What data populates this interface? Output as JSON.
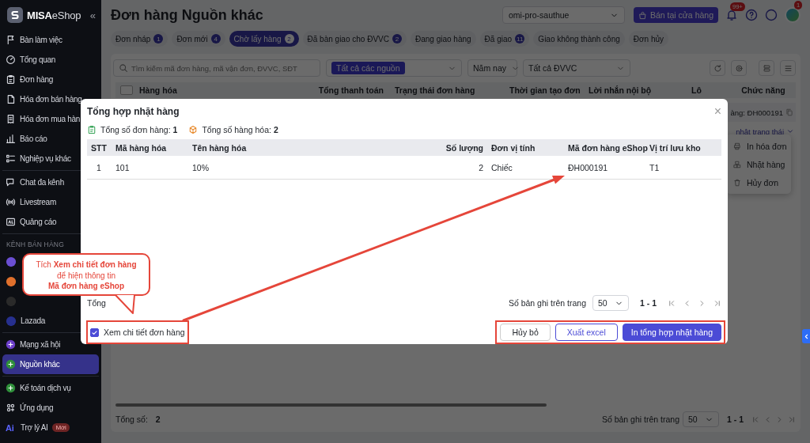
{
  "sidebar": {
    "brand": "**MISA**eShop",
    "collapse": "«",
    "groups": [
      {
        "kind": "menu",
        "items": [
          {
            "label": "Bàn làm việc",
            "selected": false
          },
          {
            "label": "Tổng quan",
            "selected": false
          },
          {
            "label": "Đơn hàng",
            "selected": false
          },
          {
            "label": "Hóa đơn bán hàng",
            "selected": false
          },
          {
            "label": "Hóa đơn mua hàn",
            "selected": false
          },
          {
            "label": "Báo cáo",
            "selected": false
          },
          {
            "label": "Nghiệp vụ khác",
            "selected": false
          }
        ]
      },
      {
        "kind": "menu",
        "items": [
          {
            "label": "Chat đa kênh",
            "selected": false
          },
          {
            "label": "Livestream",
            "selected": false
          },
          {
            "label": "Quảng cáo",
            "selected": false
          }
        ]
      },
      {
        "kind": "channels",
        "heading": "KÊNH BÁN HÀNG",
        "items": [
          {
            "color": "#6b4fd3",
            "selected": false
          },
          {
            "color": "#e0702c",
            "selected": false
          },
          {
            "color": "#2a2a2a",
            "selected": false
          },
          {
            "label": "Lazada",
            "color": "#27308f",
            "selected": false
          }
        ]
      },
      {
        "kind": "menu",
        "items": [
          {
            "label": "Mạng xã hội",
            "selected": false
          },
          {
            "label": "Nguồn khác",
            "selected": true
          }
        ]
      },
      {
        "kind": "menu",
        "items": [
          {
            "label": "Kế toán dịch vụ",
            "selected": false
          },
          {
            "label": "Ứng dụng",
            "selected": false
          },
          {
            "label": "Trợ lý AI",
            "icon_text": "Ai",
            "badge": "Mới",
            "selected": false
          }
        ]
      }
    ]
  },
  "header": {
    "title": "Đơn hàng Nguồn khác",
    "store": "omi-pro-sauthue",
    "store_button": "Bán tại cửa hàng",
    "notification_badge": "99+",
    "avatar_badge": "1"
  },
  "tabs": [
    {
      "label": "Đơn nháp",
      "count": "1",
      "selected": false
    },
    {
      "label": "Đơn mới",
      "count": "4",
      "selected": false
    },
    {
      "label": "Chờ lấy hàng",
      "count": "2",
      "selected": true
    },
    {
      "label": "Đã bàn giao cho ĐVVC",
      "count": "2",
      "selected": false
    },
    {
      "label": "Đang giao hàng",
      "selected": false
    },
    {
      "label": "Đã giao",
      "count": "11",
      "selected": false
    },
    {
      "label": "Giao không thành công",
      "selected": false
    },
    {
      "label": "Đơn hủy",
      "selected": false
    }
  ],
  "filters": {
    "search_placeholder": "Tìm kiếm mã đơn hàng, mã vận đơn, ĐVVC, SĐT",
    "source": "Tất cả các nguồn",
    "period": "Năm nay",
    "carrier": "Tất cả ĐVVC"
  },
  "orders": {
    "select_all_checked": false,
    "columns": [
      "Hàng hóa",
      "Tổng thanh toán",
      "Trạng thái đơn hàng",
      "Thời gian tạo đơn",
      "Lời nhắn nội bộ",
      "Lô",
      "Chức năng"
    ],
    "order_code": "àng: ĐH000191",
    "action": "nhật trạng thái",
    "menu": [
      "In hóa đơn",
      "Nhặt hàng",
      "Hủy đơn"
    ],
    "total_label": "Tổng số:",
    "total": "2",
    "page_size_label": "Số bản ghi trên trang",
    "page_size": "50",
    "range": "1 - 1"
  },
  "modal": {
    "title": "Tổng hợp nhặt hàng",
    "close": "×",
    "stats": [
      "Tổng số đơn hàng: **1**",
      "Tổng số hàng hóa: **2**"
    ],
    "columns": [
      "STT",
      "Mã hàng hóa",
      "Tên hàng hóa",
      "Số lượng",
      "Đơn vị tính",
      "Mã đơn hàng eShop",
      "Vị trí lưu kho"
    ],
    "rows": [
      [
        "1",
        "101",
        "10%",
        "2",
        "Chiếc",
        "ĐH000191",
        "T1"
      ]
    ],
    "footer_text": "Tổng",
    "page_size_label": "Số bản ghi trên trang",
    "page_size": "50",
    "range": "1 - 1",
    "detail_checkbox": {
      "label": "Xem chi tiết đơn hàng",
      "checked": true
    },
    "buttons": [
      {
        "label": "Hủy bỏ",
        "kind": "default"
      },
      {
        "label": "Xuất excel",
        "kind": "outline"
      },
      {
        "label": "In tổng hợp nhặt hàng",
        "kind": "primary"
      }
    ]
  },
  "annotation": {
    "lines": [
      "Tích **Xem chi tiết đơn hàng**",
      "để hiện thông tin",
      "**Mã đơn hàng eShop**"
    ]
  }
}
